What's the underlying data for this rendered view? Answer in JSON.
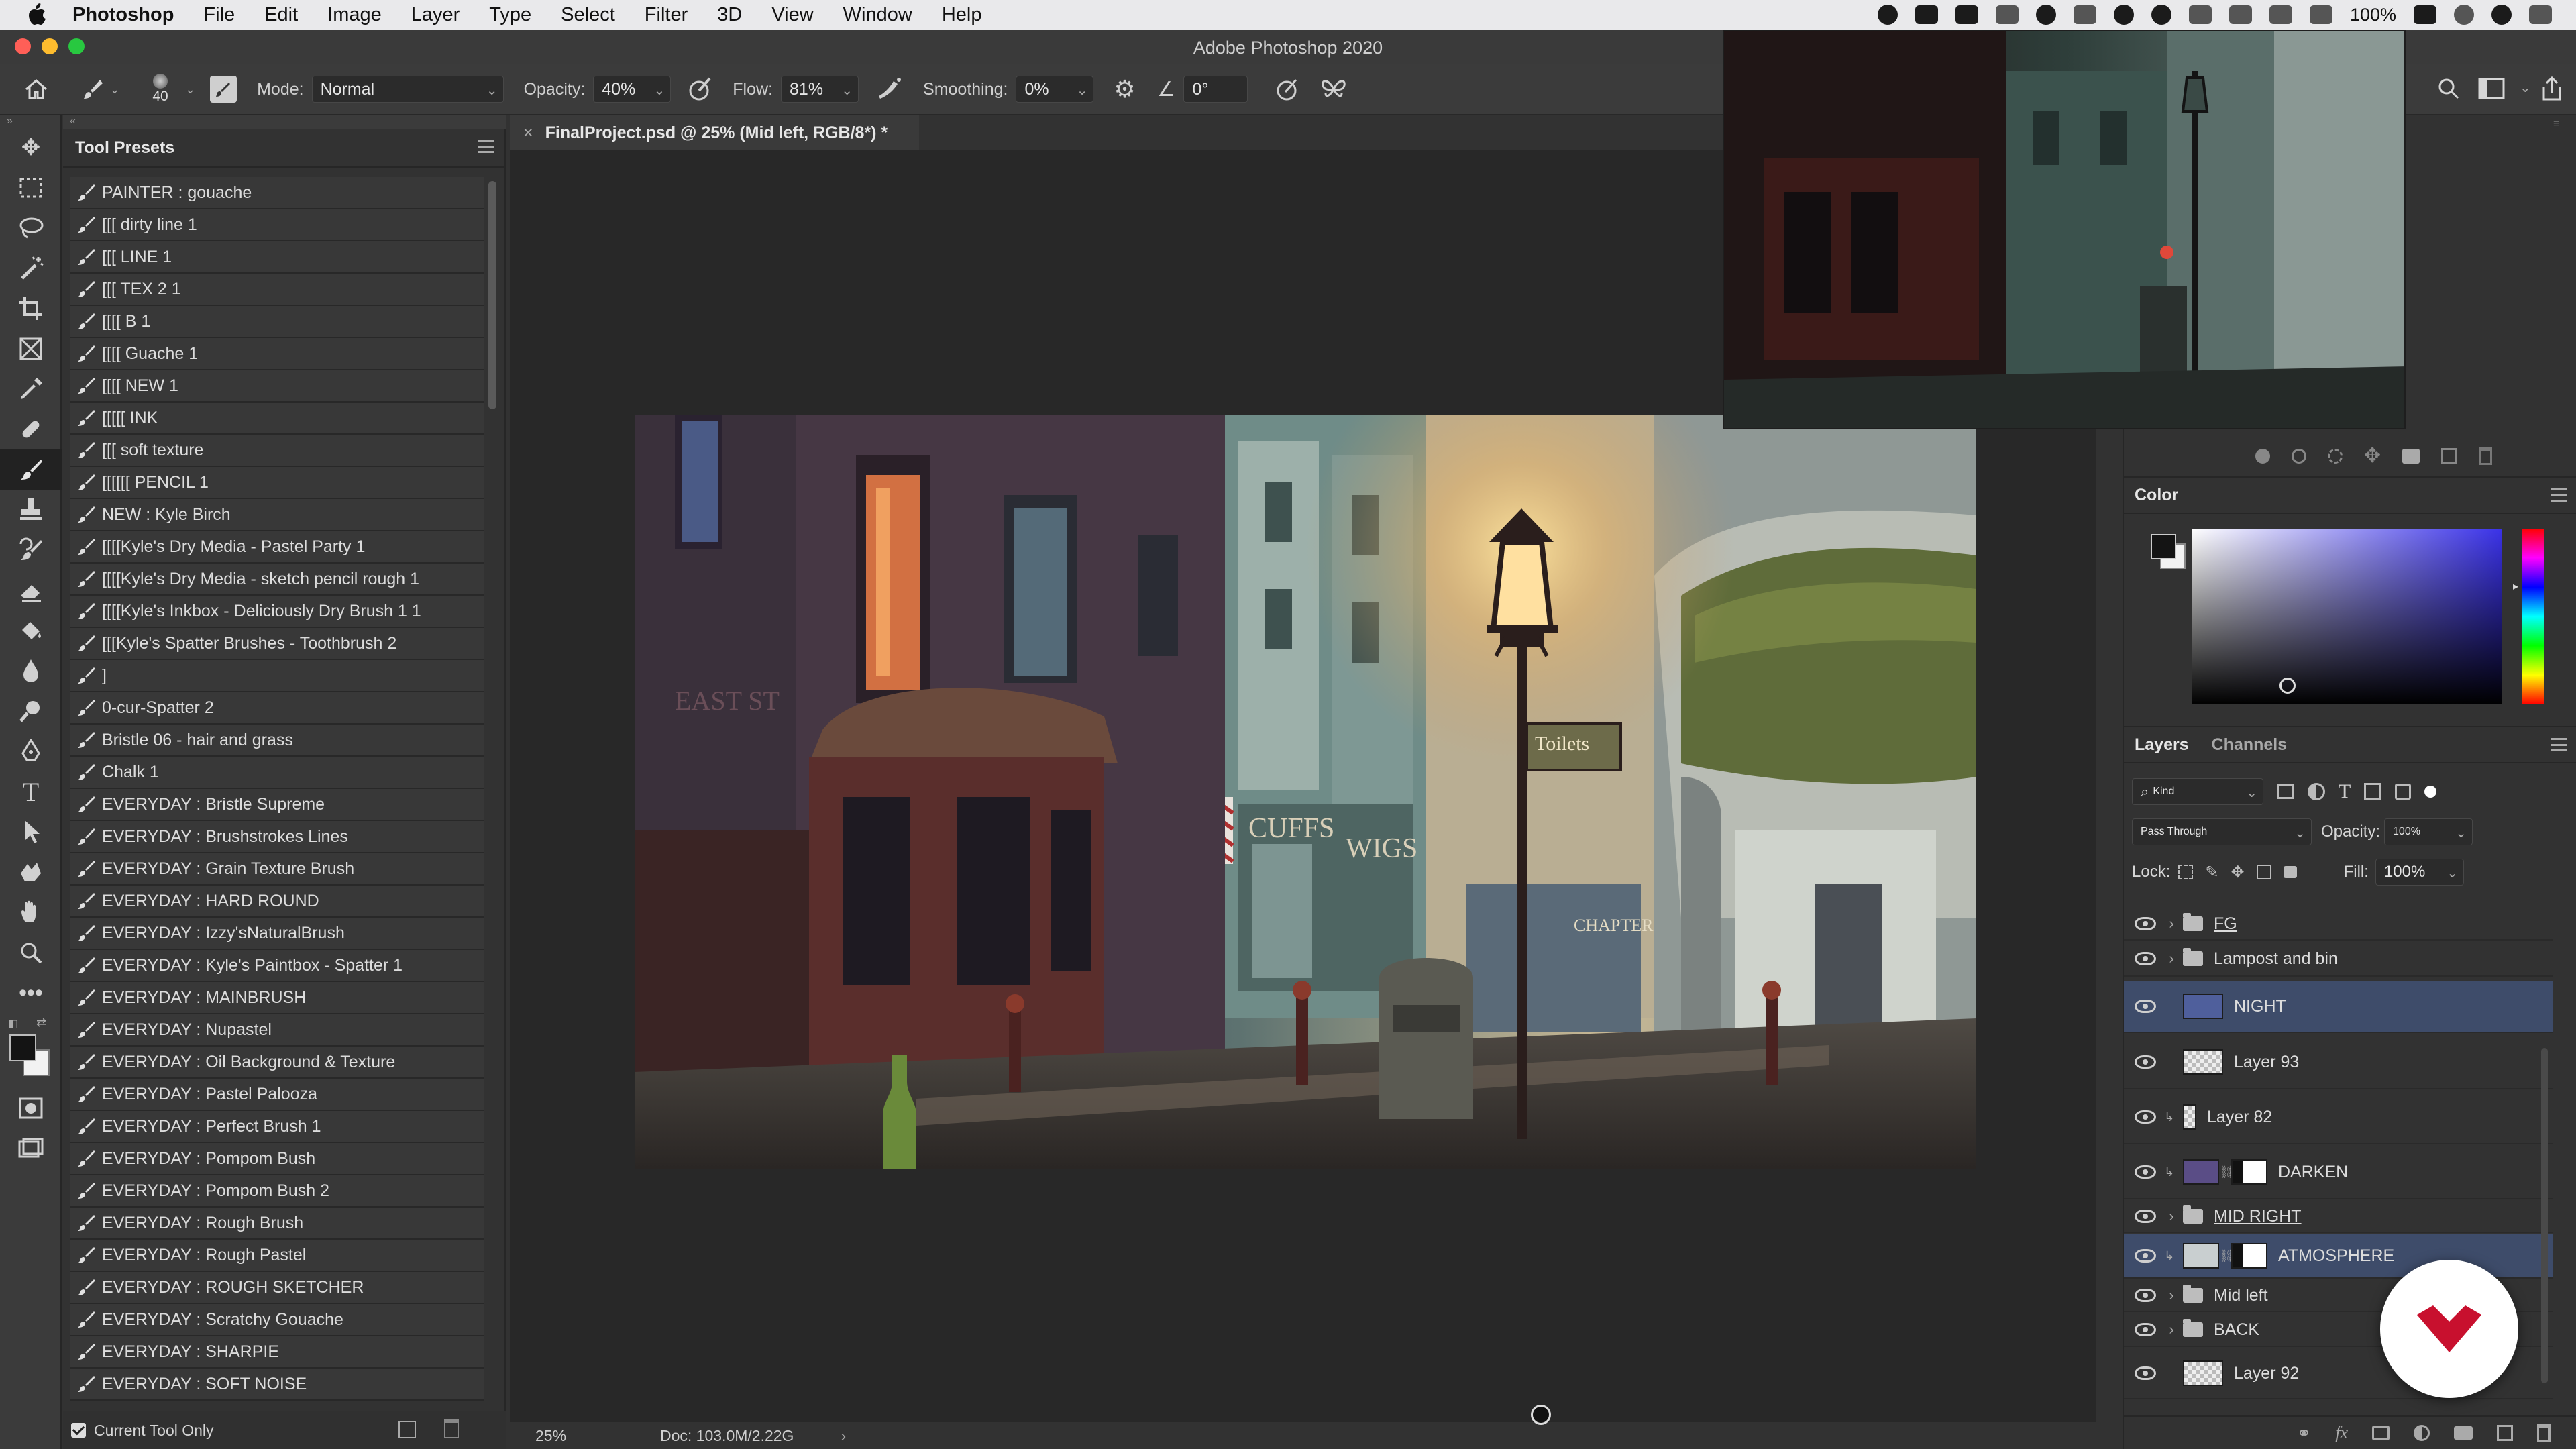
{
  "menubar": {
    "items": [
      "Photoshop",
      "File",
      "Edit",
      "Image",
      "Layer",
      "Type",
      "Select",
      "Filter",
      "3D",
      "View",
      "Window",
      "Help"
    ],
    "battery": "100%"
  },
  "window": {
    "title": "Adobe Photoshop 2020"
  },
  "options": {
    "brush_size": "40",
    "mode_label": "Mode:",
    "mode_value": "Normal",
    "opacity_label": "Opacity:",
    "opacity_value": "40%",
    "flow_label": "Flow:",
    "flow_value": "81%",
    "smoothing_label": "Smoothing:",
    "smoothing_value": "0%",
    "angle_value": "0°"
  },
  "tool_presets": {
    "title": "Tool Presets",
    "items": [
      "PAINTER : gouache",
      "[[[ dirty line 1",
      "[[[ LINE 1",
      "[[[ TEX 2 1",
      "[[[[ B 1",
      "[[[[ Guache 1",
      "[[[[ NEW 1",
      "[[[[[ INK",
      "[[[ soft texture",
      "[[[[[[ PENCIL 1",
      "NEW : Kyle Birch",
      "[[[[Kyle's Dry Media - Pastel Party 1",
      "[[[[Kyle's Dry Media - sketch pencil rough 1",
      "[[[[Kyle's Inkbox - Deliciously Dry Brush 1 1",
      "[[[Kyle's Spatter Brushes - Toothbrush 2",
      "]",
      "0-cur-Spatter 2",
      "Bristle 06 - hair and grass",
      "Chalk 1",
      "EVERYDAY : Bristle Supreme",
      "EVERYDAY : Brushstrokes Lines",
      "EVERYDAY : Grain Texture Brush",
      "EVERYDAY : HARD ROUND",
      "EVERYDAY : Izzy'sNaturalBrush",
      "EVERYDAY : Kyle's Paintbox - Spatter 1",
      "EVERYDAY : MAINBRUSH",
      "EVERYDAY : Nupastel",
      "EVERYDAY : Oil Background & Texture",
      "EVERYDAY : Pastel Palooza",
      "EVERYDAY : Perfect Brush 1",
      "EVERYDAY : Pompom Bush",
      "EVERYDAY : Pompom Bush 2",
      "EVERYDAY : Rough Brush",
      "EVERYDAY : Rough Pastel",
      "EVERYDAY : ROUGH SKETCHER",
      "EVERYDAY : Scratchy Gouache",
      "EVERYDAY : SHARPIE",
      "EVERYDAY : SOFT NOISE"
    ],
    "footer_label": "Current Tool Only"
  },
  "document": {
    "tab_title": "FinalProject.psd @ 25% (Mid left, RGB/8*) *",
    "zoom": "25%",
    "doc_info": "Doc: 103.0M/2.22G"
  },
  "color_panel": {
    "title": "Color"
  },
  "layers_panel": {
    "tab_layers": "Layers",
    "tab_channels": "Channels",
    "filter_kind": "Kind",
    "blend_mode": "Pass Through",
    "opacity_label": "Opacity:",
    "opacity_value": "100%",
    "lock_label": "Lock:",
    "fill_label": "Fill:",
    "fill_value": "100%",
    "layers": [
      {
        "name": "FG",
        "type": "group"
      },
      {
        "name": "Lampost and bin",
        "type": "group"
      },
      {
        "name": "NIGHT",
        "type": "fill"
      },
      {
        "name": "Layer 93",
        "type": "pixel"
      },
      {
        "name": "Layer 82",
        "type": "pixel"
      },
      {
        "name": "DARKEN",
        "type": "masked"
      },
      {
        "name": "MID RIGHT",
        "type": "group"
      },
      {
        "name": "ATMOSPHERE",
        "type": "masked"
      },
      {
        "name": "Mid left",
        "type": "group"
      },
      {
        "name": "BACK",
        "type": "group"
      },
      {
        "name": "Layer 92",
        "type": "pixel"
      }
    ]
  },
  "canvas_art": {
    "sign_text": "Toilets",
    "shop_text_1": "CUFFS",
    "shop_text_2": "WIGS",
    "shop_text_3": "CHAPTER",
    "street_sign": "EAST ST"
  },
  "colors": {
    "accent_red": "#c8102e",
    "selection_blue": "#3e4c6a",
    "night_swatch": "#4f5f9c"
  }
}
